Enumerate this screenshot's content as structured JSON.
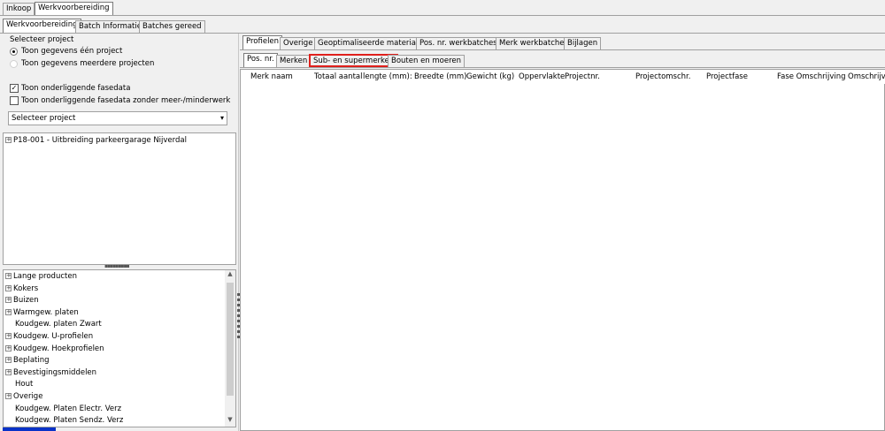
{
  "top_tabs": [
    "Inkoop",
    "Werkvoorbereiding"
  ],
  "sub_tabs": [
    "Werkvoorbereiding",
    "Batch Informatie",
    "Batches gereed"
  ],
  "left": {
    "group_label": "Selecteer project",
    "radio_one": "Toon gegevens één project",
    "radio_multi": "Toon gegevens meerdere projecten",
    "check_phase": "Toon onderliggende fasedata",
    "check_phase_no_extra": "Toon onderliggende fasedata zonder meer-/minderwerk",
    "select_value": "Selecteer project",
    "project": "P18-001 - Uitbreiding parkeergarage Nijverdal"
  },
  "materials": [
    {
      "label": "Lange producten",
      "expandable": true
    },
    {
      "label": "Kokers",
      "expandable": true
    },
    {
      "label": "Buizen",
      "expandable": true
    },
    {
      "label": "Warmgew. platen",
      "expandable": true
    },
    {
      "label": "Koudgew. platen Zwart",
      "expandable": false
    },
    {
      "label": "Koudgew. U-profielen",
      "expandable": true
    },
    {
      "label": "Koudgew. Hoekprofielen",
      "expandable": true
    },
    {
      "label": "Beplating",
      "expandable": true
    },
    {
      "label": "Bevestigingsmiddelen",
      "expandable": true
    },
    {
      "label": "Hout",
      "expandable": false
    },
    {
      "label": "Overige",
      "expandable": true
    },
    {
      "label": "Koudgew. Platen Electr. Verz",
      "expandable": false
    },
    {
      "label": "Koudgew. Platen Sendz. Verz",
      "expandable": false
    }
  ],
  "right_tabs": [
    "Profielen",
    "Overige",
    "Geoptimaliseerde materialen",
    "Pos. nr. werkbatches",
    "Merk werkbatches",
    "Bijlagen"
  ],
  "inner_tabs": [
    "Pos. nr.",
    "Merken",
    "Sub- en supermerken",
    "Bouten en moeren"
  ],
  "columns": [
    "Merk naam",
    "Totaal aantal",
    "lengte (mm):",
    "Breedte (mm)",
    "Gewicht (kg)",
    "Oppervlakte",
    "Projectnr.",
    "Projectomschr.",
    "Projectfase",
    "Fase Omschrijving",
    "Omschrijving"
  ],
  "colors": {
    "highlight_border": "#e0201c",
    "progress": "#0a32c8"
  }
}
